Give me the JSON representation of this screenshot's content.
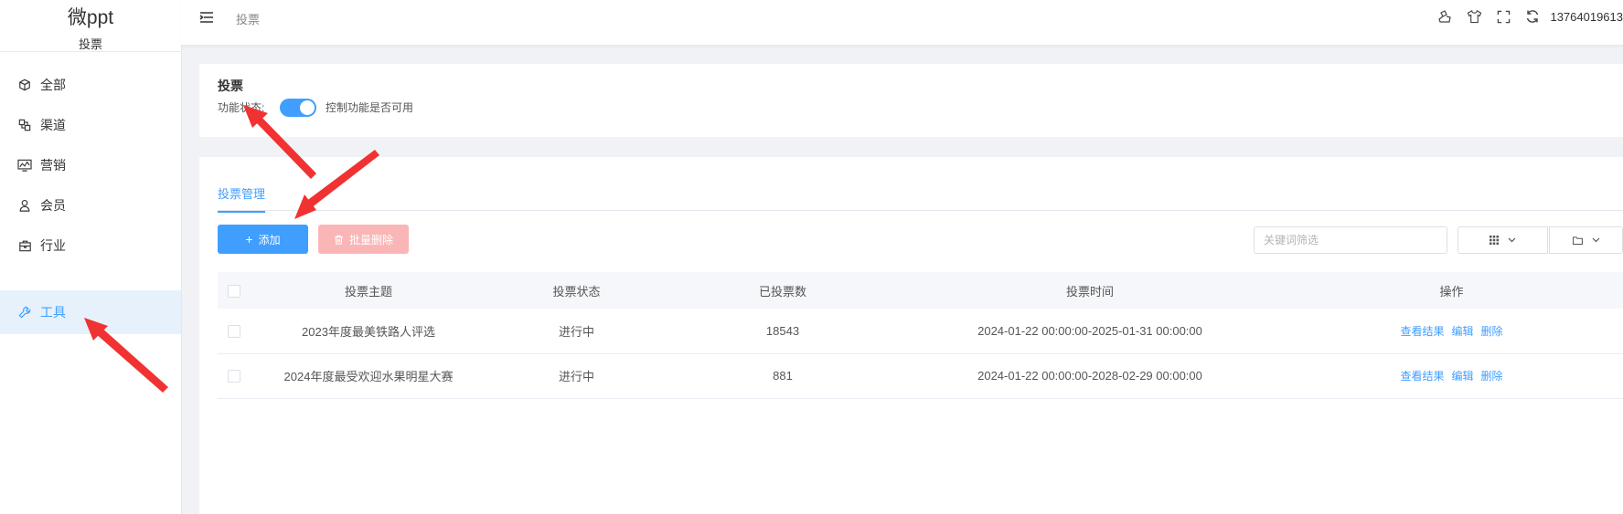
{
  "sidebar": {
    "app_name": "微ppt",
    "sub_title": "投票",
    "items": [
      {
        "label": "全部",
        "icon": "box-icon"
      },
      {
        "label": "渠道",
        "icon": "channel-icon"
      },
      {
        "label": "营销",
        "icon": "chart-monitor-icon"
      },
      {
        "label": "会员",
        "icon": "user-icon"
      },
      {
        "label": "行业",
        "icon": "briefcase-icon"
      },
      {
        "label": "工具",
        "icon": "wrench-icon",
        "active": true
      }
    ]
  },
  "header": {
    "breadcrumb": "投票",
    "user": "13764019613"
  },
  "function_panel": {
    "title": "投票",
    "status_label": "功能状态:",
    "switch_on": true,
    "switch_desc": "控制功能是否可用"
  },
  "manage_panel": {
    "tab_label": "投票管理",
    "add_button": "添加",
    "batch_delete_button": "批量删除",
    "search_placeholder": "关键词筛选",
    "columns": [
      "投票主题",
      "投票状态",
      "已投票数",
      "投票时间",
      "操作"
    ],
    "rows": [
      {
        "topic": "2023年度最美铁路人评选",
        "status": "进行中",
        "count": "18543",
        "time": "2024-01-22 00:00:00-2025-01-31 00:00:00"
      },
      {
        "topic": "2024年度最受欢迎水果明星大赛",
        "status": "进行中",
        "count": "881",
        "time": "2024-01-22 00:00:00-2028-02-29 00:00:00"
      }
    ],
    "actions": {
      "view": "查看结果",
      "edit": "编辑",
      "delete": "删除"
    }
  },
  "colors": {
    "accent": "#409eff",
    "annotation_arrow": "#f03232",
    "danger_light": "#fab6b6"
  }
}
